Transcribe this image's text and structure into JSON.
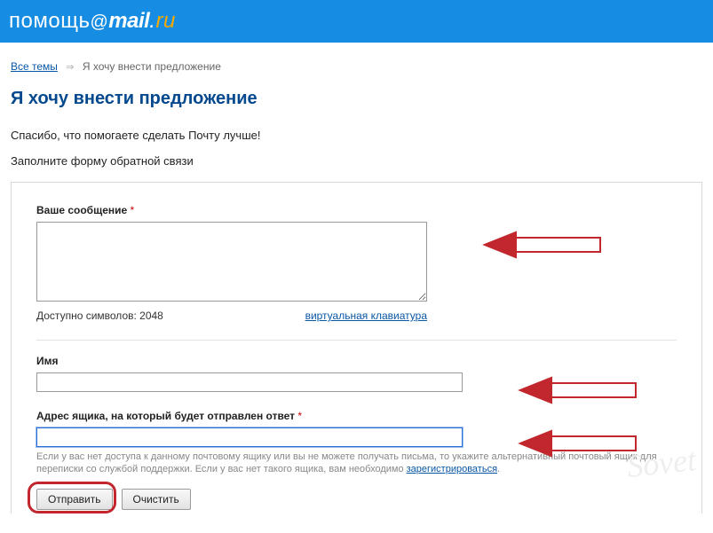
{
  "header": {
    "logo_help": "помощь",
    "logo_at": "@",
    "logo_mail": "mail",
    "logo_dot": ".",
    "logo_ru": "ru"
  },
  "breadcrumb": {
    "link": "Все темы",
    "sep": "⇒",
    "current": "Я хочу внести предложение"
  },
  "page": {
    "title": "Я хочу внести предложение",
    "intro": "Спасибо, что помогаете сделать Почту лучше!",
    "sub": "Заполните форму обратной связи"
  },
  "form": {
    "message": {
      "label": "Ваше сообщение",
      "required": "*",
      "value": "",
      "counter": "Доступно символов: 2048",
      "vk_link": "виртуальная клавиатура"
    },
    "name": {
      "label": "Имя",
      "value": ""
    },
    "email": {
      "label": "Адрес ящика, на который будет отправлен ответ",
      "required": "*",
      "value": "",
      "hint_pre": "Если у вас нет доступа к данному почтовому ящику или вы не можете получать письма, то укажите альтернативный почтовый ящик для переписки со службой поддержки. Если у вас нет такого ящика, вам необходимо ",
      "hint_link": "зарегистрироваться",
      "hint_post": "."
    },
    "buttons": {
      "submit": "Отправить",
      "clear": "Очистить"
    }
  },
  "watermark": "Sovet"
}
